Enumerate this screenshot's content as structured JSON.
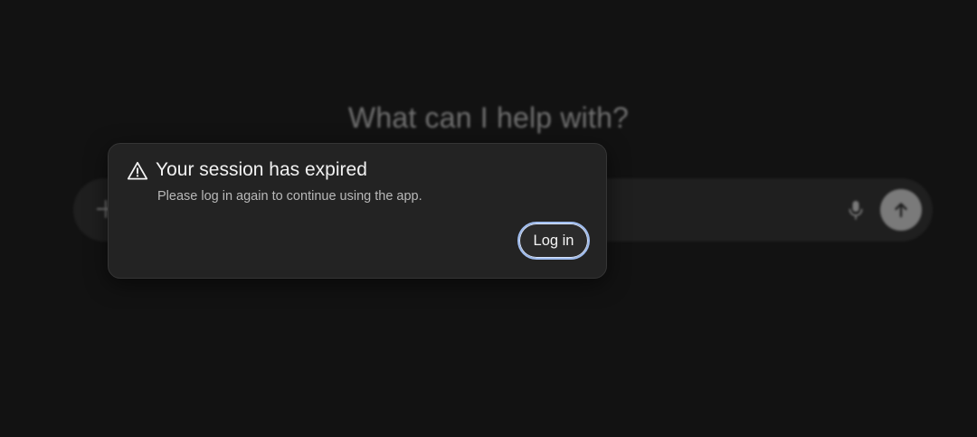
{
  "background": {
    "heading": "What can I help with?",
    "composer": {
      "plus_icon": "plus-icon",
      "mic_icon": "microphone-icon",
      "send_icon": "arrow-up-icon"
    }
  },
  "dialog": {
    "icon": "warning-triangle-icon",
    "title": "Your session has expired",
    "message": "Please log in again to continue using the app.",
    "login_label": "Log in"
  },
  "colors": {
    "page_bg": "#121212",
    "dialog_bg": "#232323",
    "button_focus_ring": "#9fbcee"
  }
}
